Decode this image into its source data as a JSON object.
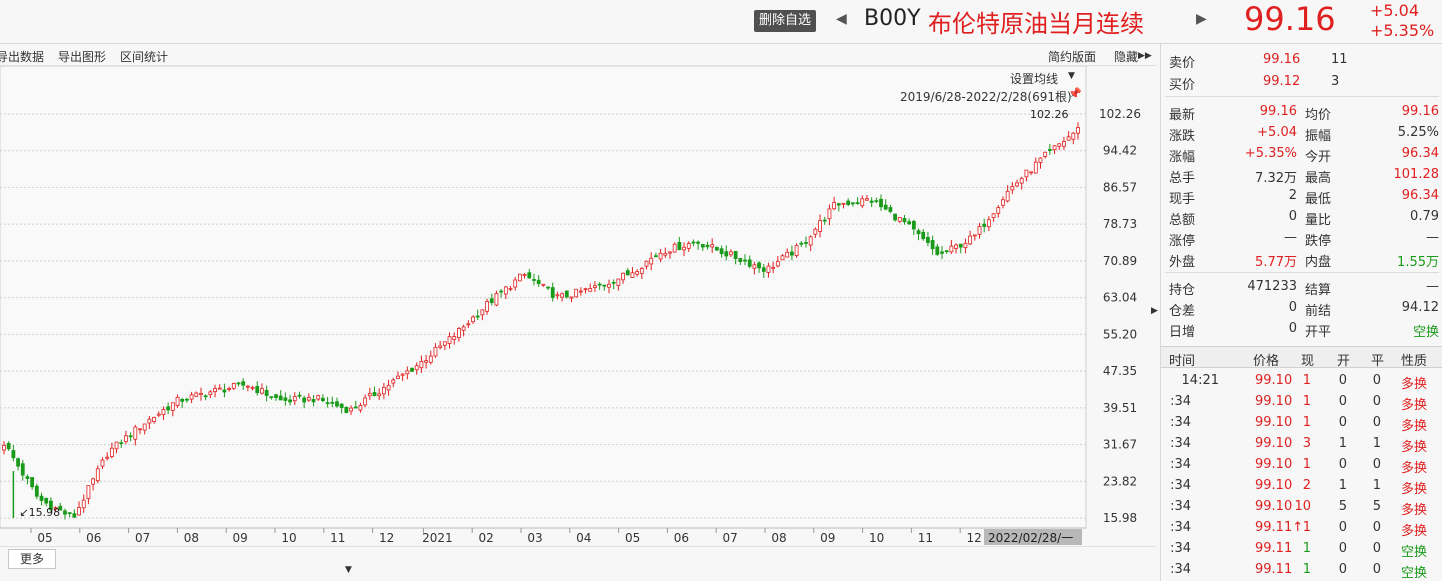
{
  "header": {
    "remove_watch_label": "删除自选",
    "prev_arrow": "◀",
    "next_arrow": "▶",
    "symbol_code": "B00Y",
    "symbol_name": "布伦特原油当月连续",
    "last_price": "99.16",
    "change_abs": "+5.04",
    "change_pct": "+5.35%"
  },
  "toolbar": {
    "export_data": "导出数据",
    "export_chart": "导出图形",
    "range_stats": "区间统计",
    "simple_layout": "简约版面",
    "hide": "隐藏",
    "hide_arrow": "▶▶"
  },
  "chart": {
    "ma_setting": "设置均线",
    "range_label": "2019/6/28-2022/2/28(691根)",
    "max_label": "102.26",
    "min_label": "↙15.98",
    "cursor_date": "2022/02/28/一"
  },
  "bottom": {
    "more_tab": "更多"
  },
  "chart_data": {
    "type": "candlestick",
    "yticks": [
      102.26,
      94.42,
      86.57,
      78.73,
      70.89,
      63.04,
      55.2,
      47.35,
      39.51,
      31.67,
      23.82,
      15.98
    ],
    "ylim": [
      15.98,
      102.26
    ],
    "xticks": [
      "05",
      "06",
      "07",
      "08",
      "09",
      "10",
      "11",
      "12",
      "2021",
      "02",
      "03",
      "04",
      "05",
      "06",
      "07",
      "08",
      "09",
      "10",
      "11",
      "12"
    ],
    "max_value": 102.26,
    "min_value": 15.98,
    "candle_count": 691,
    "trend_path": [
      [
        "2020-04",
        32
      ],
      [
        "2020-04",
        20
      ],
      [
        "2020-04",
        16
      ],
      [
        "2020-05",
        30
      ],
      [
        "2020-05",
        36
      ],
      [
        "2020-06",
        41
      ],
      [
        "2020-07",
        43
      ],
      [
        "2020-08",
        44.5
      ],
      [
        "2020-09",
        41
      ],
      [
        "2020-10",
        41.5
      ],
      [
        "2020-11",
        39
      ],
      [
        "2020-11",
        44
      ],
      [
        "2020-12",
        49
      ],
      [
        "2021-01",
        55
      ],
      [
        "2021-02",
        62
      ],
      [
        "2021-03",
        68
      ],
      [
        "2021-03",
        63
      ],
      [
        "2021-04",
        65
      ],
      [
        "2021-05",
        68
      ],
      [
        "2021-06",
        73
      ],
      [
        "2021-07",
        75
      ],
      [
        "2021-08",
        72
      ],
      [
        "2021-08",
        69
      ],
      [
        "2021-09",
        74
      ],
      [
        "2021-10",
        83
      ],
      [
        "2021-11",
        84
      ],
      [
        "2021-11",
        79
      ],
      [
        "2021-12",
        72
      ],
      [
        "2021-12",
        76
      ],
      [
        "2022-01",
        86
      ],
      [
        "2022-02",
        93
      ],
      [
        "2022-02",
        99
      ]
    ]
  },
  "quote": {
    "ask_label": "卖价",
    "ask_price": "99.16",
    "ask_vol": "11",
    "bid_label": "买价",
    "bid_price": "99.12",
    "bid_vol": "3",
    "rows": [
      {
        "l1": "最新",
        "v1": "99.16",
        "c1": "red",
        "l2": "均价",
        "v2": "99.16",
        "c2": "red"
      },
      {
        "l1": "涨跌",
        "v1": "+5.04",
        "c1": "red",
        "l2": "振幅",
        "v2": "5.25%",
        "c2": "dark"
      },
      {
        "l1": "涨幅",
        "v1": "+5.35%",
        "c1": "red",
        "l2": "今开",
        "v2": "96.34",
        "c2": "red"
      },
      {
        "l1": "总手",
        "v1": "7.32万",
        "c1": "dark",
        "l2": "最高",
        "v2": "101.28",
        "c2": "red"
      },
      {
        "l1": "现手",
        "v1": "2",
        "c1": "dark",
        "l2": "最低",
        "v2": "96.34",
        "c2": "red"
      },
      {
        "l1": "总额",
        "v1": "0",
        "c1": "dark",
        "l2": "量比",
        "v2": "0.79",
        "c2": "dark"
      },
      {
        "l1": "涨停",
        "v1": "—",
        "c1": "dark",
        "l2": "跌停",
        "v2": "—",
        "c2": "dark"
      },
      {
        "l1": "外盘",
        "v1": "5.77万",
        "c1": "red",
        "l2": "内盘",
        "v2": "1.55万",
        "c2": "green"
      }
    ],
    "rows2": [
      {
        "l1": "持仓",
        "v1": "471233",
        "c1": "dark",
        "l2": "结算",
        "v2": "—",
        "c2": "dark"
      },
      {
        "l1": "仓差",
        "v1": "0",
        "c1": "dark",
        "l2": "前结",
        "v2": "94.12",
        "c2": "dark"
      },
      {
        "l1": "日增",
        "v1": "0",
        "c1": "dark",
        "l2": "开平",
        "v2": "空换",
        "c2": "green"
      }
    ],
    "side_arrow": "▶"
  },
  "ticks": {
    "headers": [
      "时间",
      "价格",
      "现",
      "开",
      "平",
      "性质"
    ],
    "rows": [
      {
        "time": "14:21",
        "price": "99.10",
        "vol": "1",
        "open": "0",
        "close": "0",
        "nature": "多换",
        "ncolor": "red",
        "vcolor": "red"
      },
      {
        "time": ":34",
        "price": "99.10",
        "vol": "1",
        "open": "0",
        "close": "0",
        "nature": "多换",
        "ncolor": "red",
        "vcolor": "red"
      },
      {
        "time": ":34",
        "price": "99.10",
        "vol": "1",
        "open": "0",
        "close": "0",
        "nature": "多换",
        "ncolor": "red",
        "vcolor": "red"
      },
      {
        "time": ":34",
        "price": "99.10",
        "vol": "3",
        "open": "1",
        "close": "1",
        "nature": "多换",
        "ncolor": "red",
        "vcolor": "red"
      },
      {
        "time": ":34",
        "price": "99.10",
        "vol": "1",
        "open": "0",
        "close": "0",
        "nature": "多换",
        "ncolor": "red",
        "vcolor": "red"
      },
      {
        "time": ":34",
        "price": "99.10",
        "vol": "2",
        "open": "1",
        "close": "1",
        "nature": "多换",
        "ncolor": "red",
        "vcolor": "red"
      },
      {
        "time": ":34",
        "price": "99.10",
        "vol": "10",
        "open": "5",
        "close": "5",
        "nature": "多换",
        "ncolor": "red",
        "vcolor": "red"
      },
      {
        "time": ":34",
        "price": "99.11↑",
        "vol": "1",
        "open": "0",
        "close": "0",
        "nature": "多换",
        "ncolor": "red",
        "vcolor": "red"
      },
      {
        "time": ":34",
        "price": "99.11",
        "vol": "1",
        "open": "0",
        "close": "0",
        "nature": "空换",
        "ncolor": "green",
        "vcolor": "green"
      },
      {
        "time": ":34",
        "price": "99.11",
        "vol": "1",
        "open": "0",
        "close": "0",
        "nature": "空换",
        "ncolor": "green",
        "vcolor": "green"
      }
    ]
  },
  "colors": {
    "up": "#e02020",
    "down": "#1a9a1a",
    "grid": "#d0d0d0"
  }
}
